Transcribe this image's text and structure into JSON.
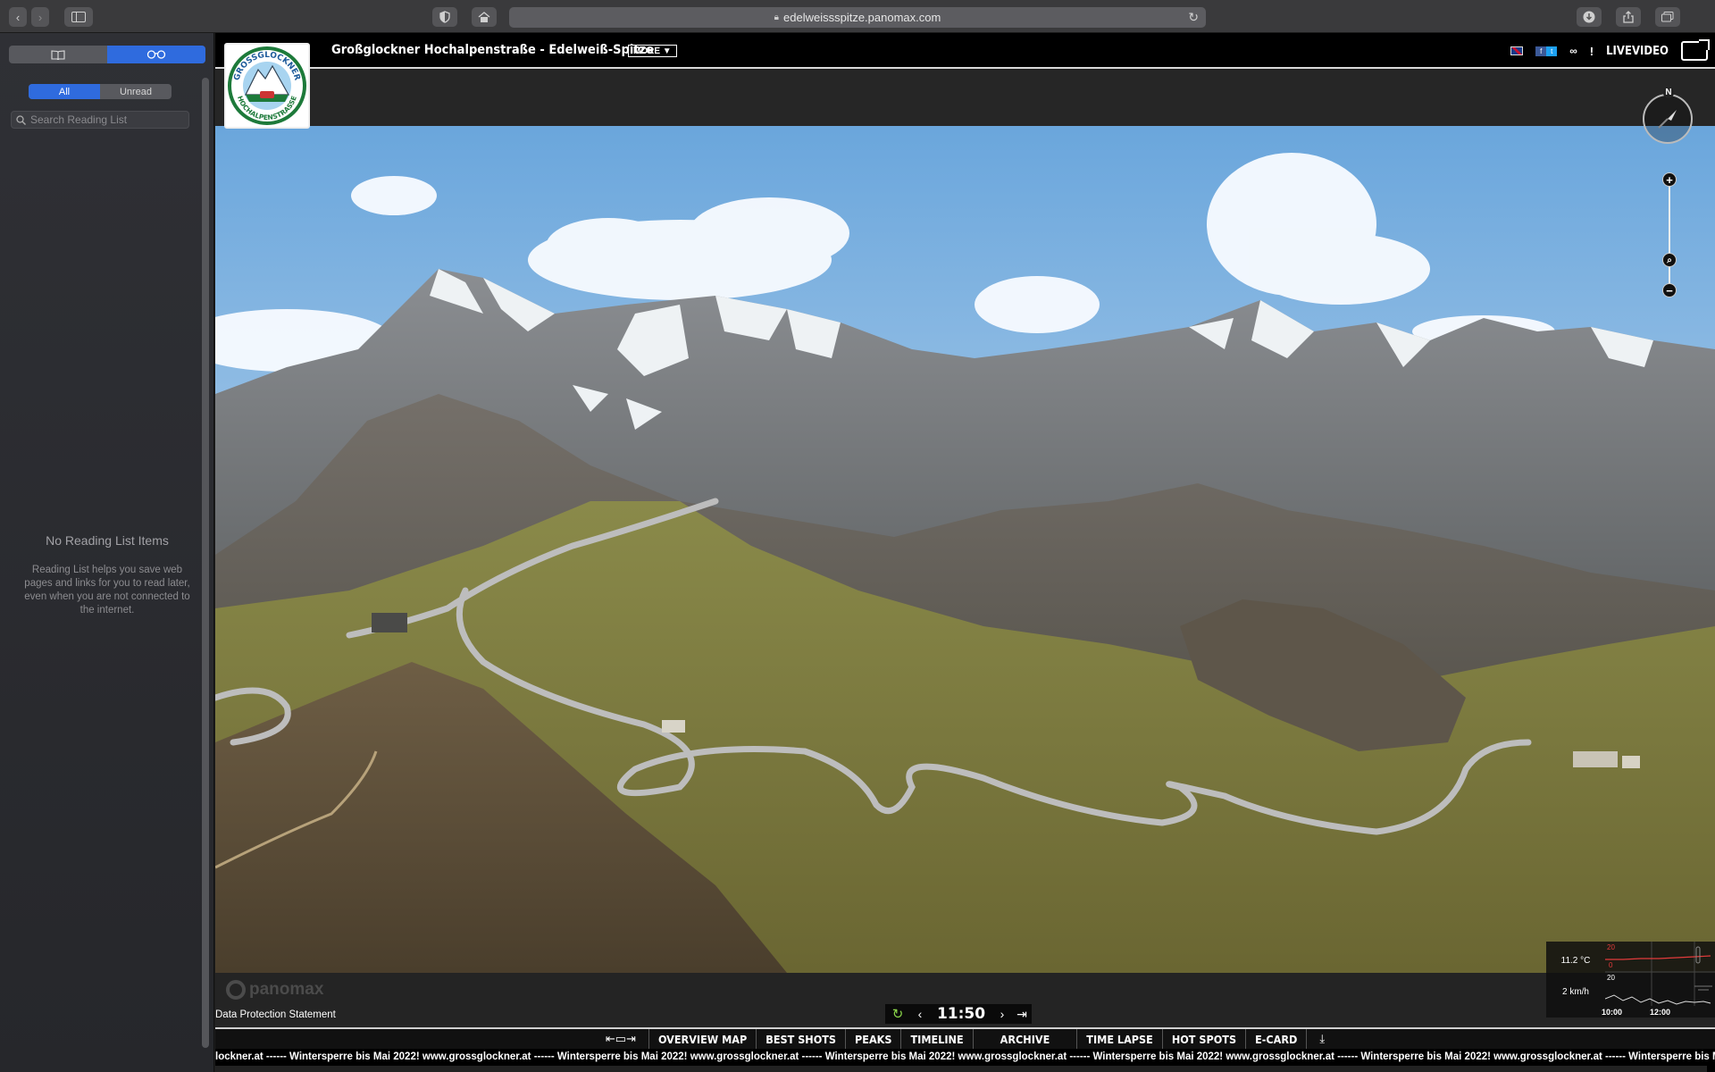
{
  "browser": {
    "url": "edelweissspitze.panomax.com",
    "icons": {
      "back": "chevron-left-icon",
      "forward": "chevron-right-icon",
      "sidebar": "sidebar-icon",
      "shield": "shield-icon",
      "home": "home-icon",
      "lock": "lock-icon",
      "reload": "reload-icon",
      "download": "download-icon",
      "share": "share-icon",
      "tabs": "tabs-overview-icon"
    }
  },
  "sidebar": {
    "tabs": [
      "bookmarks",
      "reading-list"
    ],
    "filter": {
      "all": "All",
      "unread": "Unread"
    },
    "search_placeholder": "Search Reading List",
    "empty_title": "No Reading List Items",
    "empty_desc": "Reading List helps you save web pages and links for you to read later, even when you are not connected to the internet."
  },
  "page": {
    "title": "Großglockner Hochalpenstraße - Edelweiß-Spitze",
    "more": "MORE",
    "header_right": {
      "info": "!",
      "live_video": "LIVEVIDEO"
    },
    "logo_text": "GROSSGLOCKNER HOCHALPENSTRASSE",
    "compass_n": "N",
    "zoom": {
      "in": "+",
      "out": "−",
      "search": "⌕"
    },
    "brand": "panomax",
    "data_protection": "Data Protection Statement",
    "time": "11:50",
    "weather": {
      "temperature": "11.2 °C",
      "wind": "2 km/h",
      "scale_top": "20",
      "scale_zero": "0",
      "wind_scale": "20",
      "times": [
        "10:00",
        "12:00"
      ],
      "temp_color": "#e23b3b"
    },
    "nav": [
      "OVERVIEW MAP",
      "BEST SHOTS",
      "PEAKS",
      "TIMELINE",
      "ARCHIVE",
      "TIME LAPSE",
      "HOT SPOTS",
      "E-CARD"
    ],
    "ticker": "lockner.at ------ Wintersperre bis Mai 2022!  www.grossglockner.at ------ Wintersperre bis Mai 2022!  www.grossglockner.at ------ Wintersperre bis Mai 2022!  www.grossglockner.at ------ Wintersperre bis Mai 2022!  www.grossglockner.at ------ Wintersperre bis Mai 2022!  www.grossglockner.at ------ Wintersperre bis Mai 2022!  www.grossglockner.at ------ Wintersperre bis Ma"
  }
}
